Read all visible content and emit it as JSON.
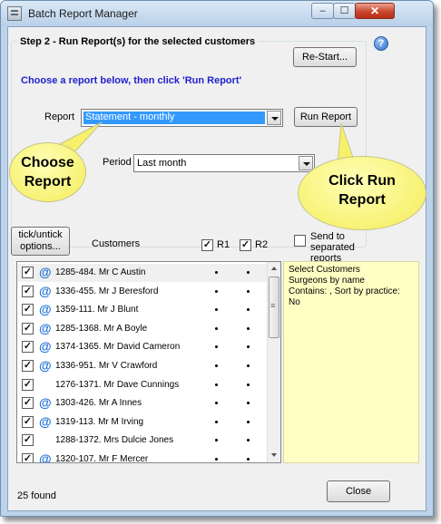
{
  "window": {
    "title": "Batch Report Manager"
  },
  "step": {
    "title": "Step 2 - Run Report(s) for the selected customers",
    "instruction": "Choose a report below, then click 'Run Report'",
    "restart_label": "Re-Start...",
    "report_label": "Report",
    "report_value": "Statement - monthly",
    "run_label": "Run Report",
    "period_label": "Period",
    "period_value": "Last month"
  },
  "list_header": {
    "tick_label": "tick/untick options...",
    "customers_label": "Customers",
    "r1_label": "R1",
    "r2_label": "R2",
    "separate_label": "Send to separated reports"
  },
  "customers": [
    {
      "name": "1285-484. Mr C Austin",
      "email": true
    },
    {
      "name": "1336-455. Mr J Beresford",
      "email": true
    },
    {
      "name": "1359-111. Mr J Blunt",
      "email": true
    },
    {
      "name": "1285-1368. Mr A Boyle",
      "email": true
    },
    {
      "name": "1374-1365. Mr David Cameron",
      "email": true
    },
    {
      "name": "1336-951. Mr V Crawford",
      "email": true
    },
    {
      "name": "1276-1371. Mr Dave Cunnings",
      "email": false
    },
    {
      "name": "1303-426. Mr A Innes",
      "email": true
    },
    {
      "name": "1319-113. Mr M Irving",
      "email": true
    },
    {
      "name": "1288-1372. Mrs Dulcie Jones",
      "email": false
    },
    {
      "name": "1320-107. Mr F Mercer",
      "email": true
    }
  ],
  "info": {
    "line1": "Select Customers",
    "line2": "Surgeons by name",
    "line3": "Contains: , Sort by practice:",
    "line4": "No"
  },
  "footer": {
    "found": "25 found",
    "close_label": "Close"
  },
  "callouts": {
    "choose_line1": "Choose",
    "choose_line2": "Report",
    "run_line1": "Click Run",
    "run_line2": "Report"
  },
  "colors": {
    "instruction": "#1f1fd0",
    "callout": "#f6f06a",
    "selection": "#3399ff",
    "email_icon": "#1d73d6"
  }
}
